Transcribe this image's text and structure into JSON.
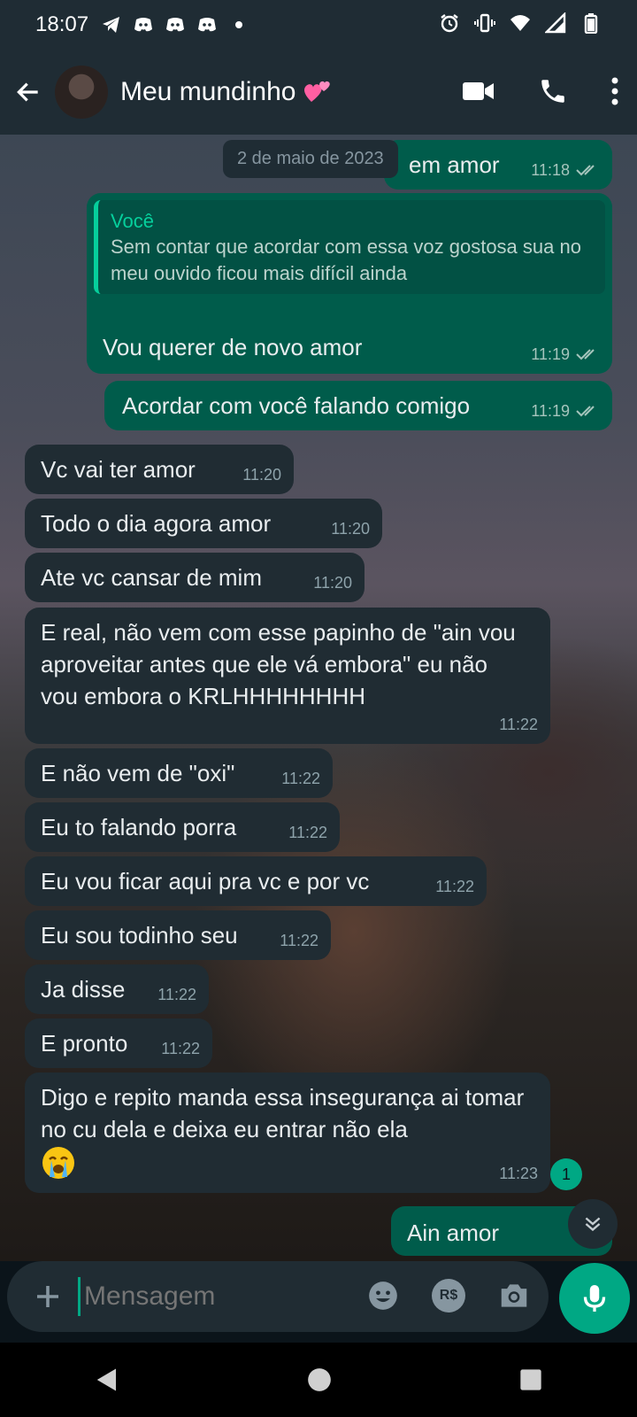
{
  "status_bar": {
    "time": "18:07",
    "left_icons": [
      "telegram-icon",
      "discord-icon",
      "discord-icon",
      "discord-icon",
      "dot-icon"
    ],
    "right_icons": [
      "alarm-icon",
      "vibrate-icon",
      "wifi-icon",
      "signal-icon",
      "battery-icon"
    ]
  },
  "header": {
    "title": "Meu mundinho",
    "title_emoji": "two-hearts-icon",
    "actions": [
      "video-call-icon",
      "phone-call-icon",
      "more-vert-icon"
    ]
  },
  "chat": {
    "date_chip": "2 de maio de 2023",
    "messages": [
      {
        "dir": "out",
        "text": "vem amor",
        "visible_text": "em amor",
        "time": "11:18",
        "read": true
      },
      {
        "dir": "out",
        "quote_author": "Você",
        "quote_text": "Sem contar que acordar com essa voz gostosa sua no meu ouvido ficou mais difícil ainda",
        "text": "Vou querer de novo amor",
        "time": "11:19",
        "read": true
      },
      {
        "dir": "out",
        "text": "Acordar com você falando comigo",
        "time": "11:19",
        "read": true
      },
      {
        "dir": "in",
        "text": "Vc vai ter amor",
        "time": "11:20"
      },
      {
        "dir": "in",
        "text": "Todo o dia agora amor",
        "time": "11:20"
      },
      {
        "dir": "in",
        "text": "Ate vc cansar de mim",
        "time": "11:20"
      },
      {
        "dir": "in",
        "text": "E real, não vem com esse papinho de \"ain vou aproveitar antes que ele vá embora\" eu não vou embora o KRLHHHHHHHH",
        "time": "11:22"
      },
      {
        "dir": "in",
        "text": "E não vem de \"oxi\"",
        "time": "11:22"
      },
      {
        "dir": "in",
        "text": "Eu to falando porra",
        "time": "11:22"
      },
      {
        "dir": "in",
        "text": "Eu vou ficar aqui pra vc e por vc",
        "time": "11:22"
      },
      {
        "dir": "in",
        "text": "Eu sou todinho seu",
        "time": "11:22"
      },
      {
        "dir": "in",
        "text": "Ja disse",
        "time": "11:22"
      },
      {
        "dir": "in",
        "text": "E pronto",
        "time": "11:22"
      },
      {
        "dir": "in",
        "text": "Digo e repito manda essa insegurança ai tomar no cu dela e deixa eu entrar não ela",
        "emoji": "crying-face-icon",
        "time": "11:23"
      },
      {
        "dir": "out",
        "text": "Ain amor",
        "time": ""
      }
    ],
    "unread_count": "1"
  },
  "composer": {
    "placeholder": "Mensagem",
    "icons": [
      "emoji-icon",
      "payment-icon",
      "camera-icon"
    ],
    "payment_label": "R$"
  },
  "colors": {
    "header_bg": "#1f2c34",
    "incoming_bubble": "#202c33",
    "outgoing_bubble": "#005c4b",
    "accent": "#00a884"
  }
}
